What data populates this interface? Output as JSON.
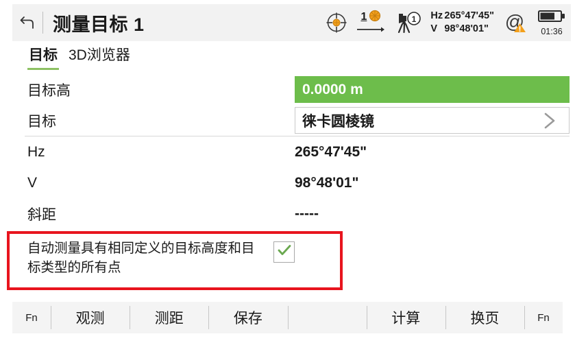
{
  "header": {
    "back_icon": "back-arrow-icon",
    "title": "测量目标 1",
    "status": {
      "target_icon": "crosshair-target-icon",
      "prism_count": "1",
      "prism_icon": "prism-icon",
      "instrument_icon": "total-station-icon",
      "instrument_badge": "1",
      "hz_label": "Hz",
      "hz_value": "265°47'45\"",
      "v_label": "V",
      "v_value": "98°48'01\"",
      "at_icon": "at-sign-warning-icon",
      "battery_icon": "battery-icon",
      "battery_time": "01:36"
    }
  },
  "tabs": [
    {
      "label": "目标",
      "active": true
    },
    {
      "label": "3D浏览器",
      "active": false
    }
  ],
  "form": {
    "rows": [
      {
        "label": "目标高",
        "value": "0.0000 m",
        "style": "green-field",
        "chevron": false
      },
      {
        "label": "目标",
        "value": "徕卡圆棱镜",
        "style": "white-field",
        "chevron": true
      },
      {
        "label": "Hz",
        "value": "265°47'45\"",
        "style": "plain"
      },
      {
        "label": "V",
        "value": "98°48'01\"",
        "style": "plain"
      },
      {
        "label": "斜距",
        "value": "-----",
        "style": "plain"
      }
    ]
  },
  "highlight": {
    "border_color": "#e8141e",
    "option_text": "自动测量具有相同定义的目标高度和目标类型的所有点",
    "checkbox_checked": true,
    "check_color": "#6aa84f"
  },
  "toolbar": {
    "left_fn": "Fn",
    "right_fn": "Fn",
    "buttons": [
      {
        "label": "观测"
      },
      {
        "label": "测距"
      },
      {
        "label": "保存"
      },
      {
        "label": ""
      },
      {
        "label": "计算"
      },
      {
        "label": "换页"
      }
    ]
  },
  "colors": {
    "accent_green": "#6dbd4b",
    "tab_underline": "#8dc163",
    "warning_orange": "#f3a01c",
    "header_bg": "#f2f2f2",
    "toolbar_bg": "#f4f4f4"
  }
}
